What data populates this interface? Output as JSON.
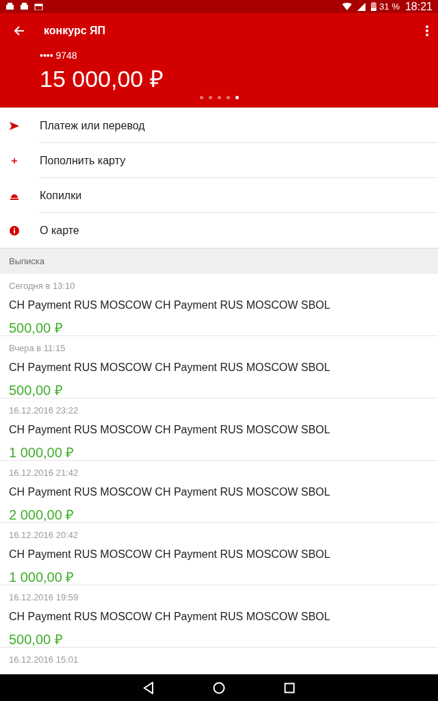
{
  "status_bar": {
    "battery": "31 %",
    "time": "18:21"
  },
  "header": {
    "title": "конкурс ЯП",
    "card_number": "•••• 9748",
    "balance": "15 000,00 ₽",
    "pager": [
      {
        "selected": false
      },
      {
        "selected": false
      },
      {
        "selected": false
      },
      {
        "selected": false
      },
      {
        "selected": true
      }
    ]
  },
  "actions": [
    {
      "kind": "send",
      "label": "Платеж или перевод"
    },
    {
      "kind": "plus",
      "label": "Пополнить карту"
    },
    {
      "kind": "piggy",
      "label": "Копилки"
    },
    {
      "kind": "info",
      "label": "О карте"
    }
  ],
  "statement": {
    "title": "Выписка",
    "items": [
      {
        "date": "Сегодня в 13:10",
        "description": "CH Payment RUS MOSCOW CH Payment RUS MOSCOW SBOL",
        "amount": "500,00 ₽"
      },
      {
        "date": "Вчера в 11:15",
        "description": "CH Payment RUS MOSCOW CH Payment RUS MOSCOW SBOL",
        "amount": "500,00 ₽"
      },
      {
        "date": "16.12.2016 23:22",
        "description": "CH Payment RUS MOSCOW CH Payment RUS MOSCOW SBOL",
        "amount": "1 000,00 ₽"
      },
      {
        "date": "16.12.2016 21:42",
        "description": "CH Payment RUS MOSCOW CH Payment RUS MOSCOW SBOL",
        "amount": "2 000,00 ₽"
      },
      {
        "date": "16.12.2016 20:42",
        "description": "CH Payment RUS MOSCOW CH Payment RUS MOSCOW SBOL",
        "amount": "1 000,00 ₽"
      },
      {
        "date": "16.12.2016 19:59",
        "description": "CH Payment RUS MOSCOW CH Payment RUS MOSCOW SBOL",
        "amount": "500,00 ₽"
      },
      {
        "date": "16.12.2016 15:01"
      }
    ]
  }
}
